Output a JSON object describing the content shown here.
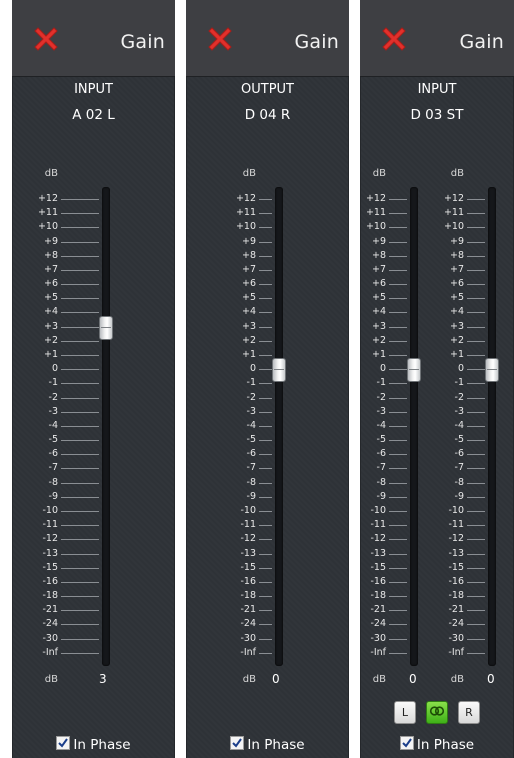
{
  "colors": {
    "panel_bg": "#2f3338",
    "header_bg": "#3e3f43",
    "close_red": "#e2302b",
    "link_green": "#52c41a"
  },
  "scale_labels": [
    "+12",
    "+11",
    "+10",
    "+9",
    "+8",
    "+7",
    "+6",
    "+5",
    "+4",
    "+3",
    "+2",
    "+1",
    "0",
    "-1",
    "-2",
    "-3",
    "-4",
    "-5",
    "-6",
    "-7",
    "-8",
    "-9",
    "-10",
    "-11",
    "-12",
    "-13",
    "-15",
    "-16",
    "-18",
    "-21",
    "-24",
    "-30",
    "-Inf"
  ],
  "panels": [
    {
      "title": "Gain",
      "io": "INPUT",
      "channel": "A 02 L",
      "db_label": "dB",
      "faders": [
        {
          "value": "3",
          "value_db": 3
        }
      ],
      "in_phase_label": "In Phase",
      "in_phase_checked": true
    },
    {
      "title": "Gain",
      "io": "OUTPUT",
      "channel": "D 04 R",
      "db_label": "dB",
      "faders": [
        {
          "value": "0",
          "value_db": 0
        }
      ],
      "in_phase_label": "In Phase",
      "in_phase_checked": true
    },
    {
      "title": "Gain",
      "io": "INPUT",
      "channel": "D 03 ST",
      "db_label": "dB",
      "faders": [
        {
          "value": "0",
          "value_db": 0
        },
        {
          "value": "0",
          "value_db": 0
        }
      ],
      "stereo_buttons": {
        "left": "L",
        "link_icon": "link-rings-icon",
        "right": "R"
      },
      "in_phase_label": "In Phase",
      "in_phase_checked": true
    }
  ]
}
